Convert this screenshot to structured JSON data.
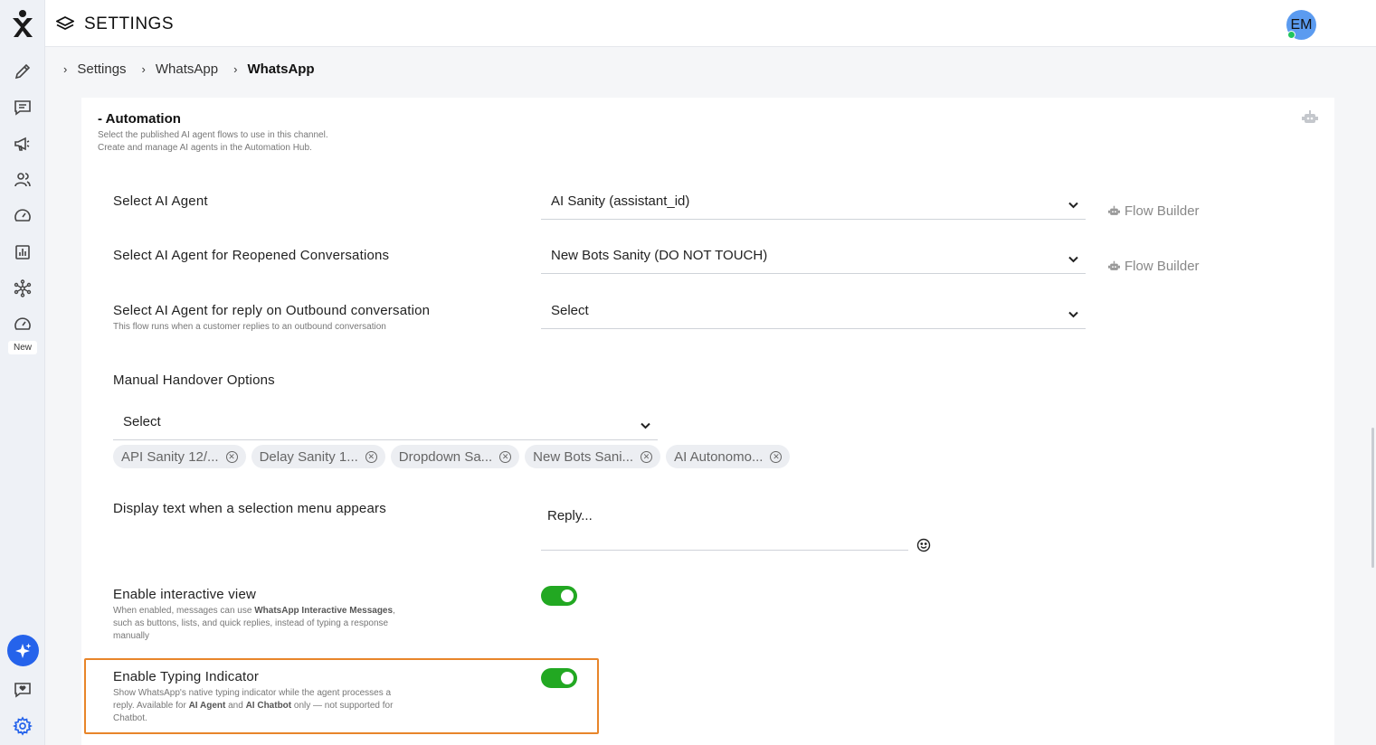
{
  "header": {
    "title": "SETTINGS",
    "avatar_initials": "EM"
  },
  "sidebar": {
    "new_badge": "New"
  },
  "breadcrumb": [
    "Settings",
    "WhatsApp",
    "WhatsApp"
  ],
  "automation": {
    "title": "- Automation",
    "description": "Select the published AI agent flows to use in this channel. Create and manage AI agents in the Automation Hub."
  },
  "fields": {
    "ai_agent": {
      "label": "Select AI Agent",
      "value": "AI Sanity (assistant_id)",
      "link": "Flow Builder"
    },
    "reopened": {
      "label": "Select AI Agent for Reopened Conversations",
      "value": "New Bots Sanity (DO NOT TOUCH)",
      "link": "Flow Builder"
    },
    "outbound": {
      "label": "Select AI Agent for reply on Outbound conversation",
      "help": "This flow runs when a customer replies to an outbound conversation",
      "value": "Select"
    },
    "handover": {
      "label": "Manual Handover Options",
      "value": "Select",
      "chips": [
        "API Sanity 12/...",
        "Delay Sanity 1...",
        "Dropdown Sa...",
        "New Bots Sani...",
        "AI Autonomo..."
      ]
    },
    "display_text": {
      "label": "Display text when a selection menu appears",
      "value": "Reply..."
    },
    "interactive": {
      "label": "Enable interactive view",
      "help_1": "When enabled, messages can use ",
      "help_bold": "WhatsApp Interactive Messages",
      "help_2": ", such as buttons, lists, and quick replies, instead of typing a response manually",
      "enabled": true
    },
    "typing": {
      "label": "Enable Typing Indicator",
      "help_1": "Show WhatsApp's native typing indicator while the agent processes a reply. Available for ",
      "help_b1": "AI Agent",
      "help_2": " and ",
      "help_b2": "AI Chatbot",
      "help_3": " only — not supported for Chatbot.",
      "enabled": true
    }
  },
  "colors": {
    "toggle_on": "#22a822",
    "highlight": "#e8852a",
    "accent": "#2563eb"
  }
}
